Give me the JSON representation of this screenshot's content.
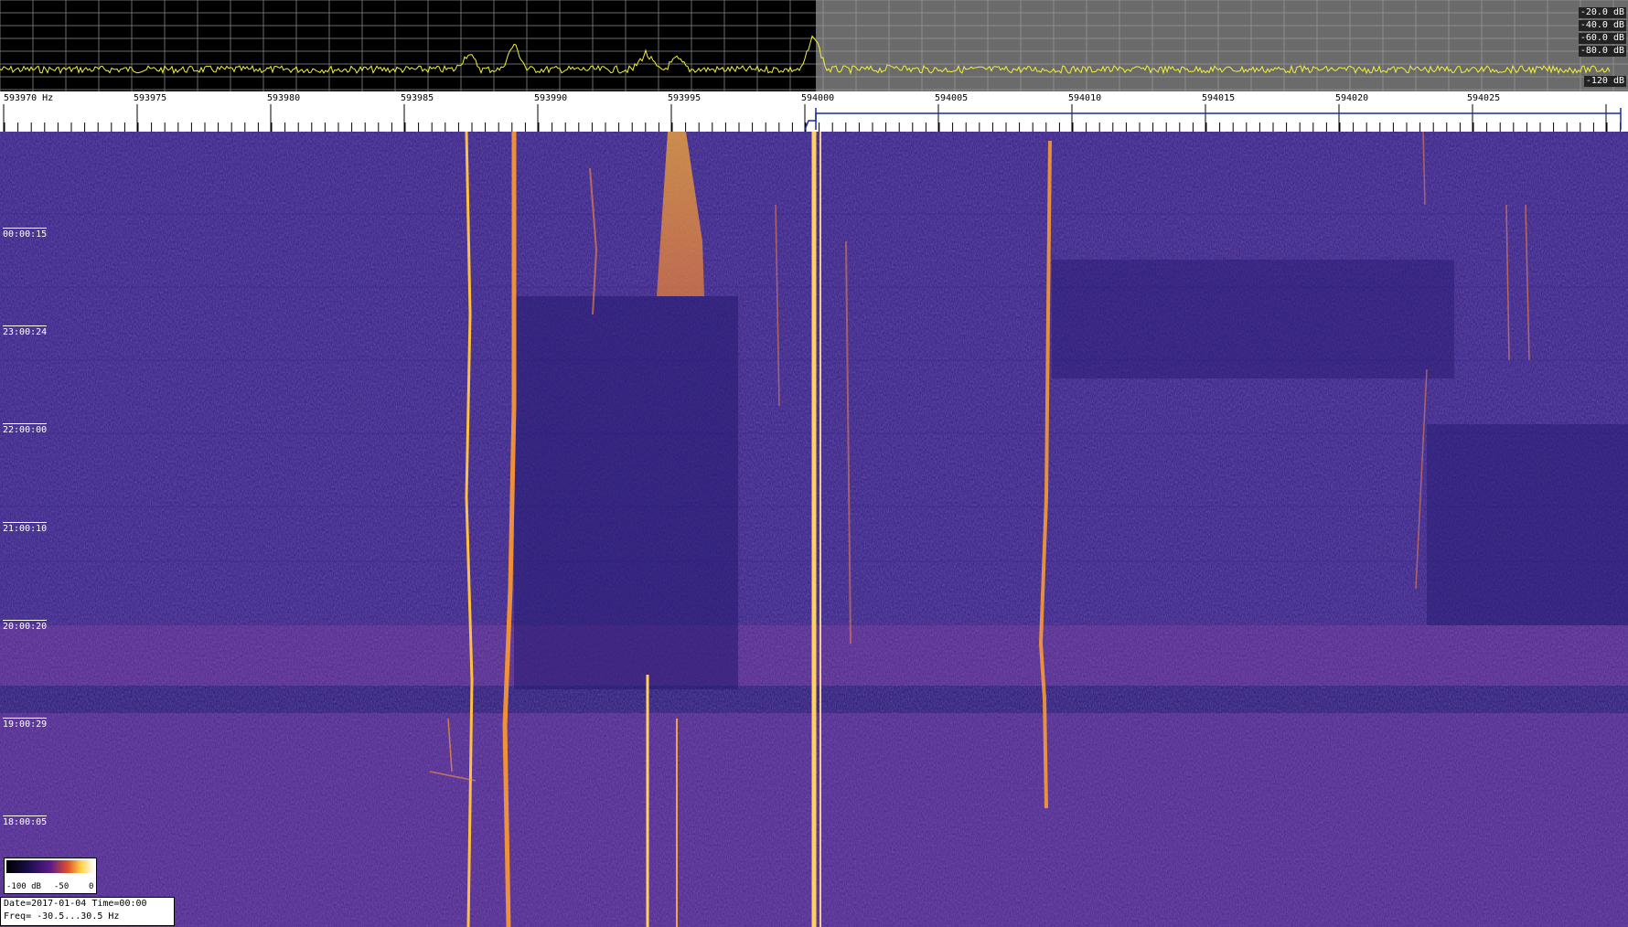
{
  "spectrum": {
    "db_labels": [
      "-20.0 dB",
      "-40.0 dB",
      "-60.0 dB",
      "-80.0 dB",
      "-120 dB"
    ],
    "trace_color": "#f2f23a"
  },
  "scale": {
    "freq_labels": [
      "593970 Hz",
      "593975",
      "593980",
      "593985",
      "593990",
      "593995",
      "594000",
      "594005",
      "594010",
      "594015",
      "594020",
      "594025"
    ]
  },
  "waterfall": {
    "time_labels": [
      "00:00:15",
      "23:00:24",
      "22:00:00",
      "21:00:10",
      "20:00:20",
      "19:00:29",
      "18:00:05"
    ],
    "background_color": "#2a1c7a",
    "signal_color": "#ffb030"
  },
  "legend": {
    "left_label": "-100 dB",
    "mid_label": "-50",
    "right_label": "0"
  },
  "info": {
    "line1": "Date=2017-01-04 Time=00:00",
    "line2": "Freq= -30.5...30.5 Hz"
  }
}
